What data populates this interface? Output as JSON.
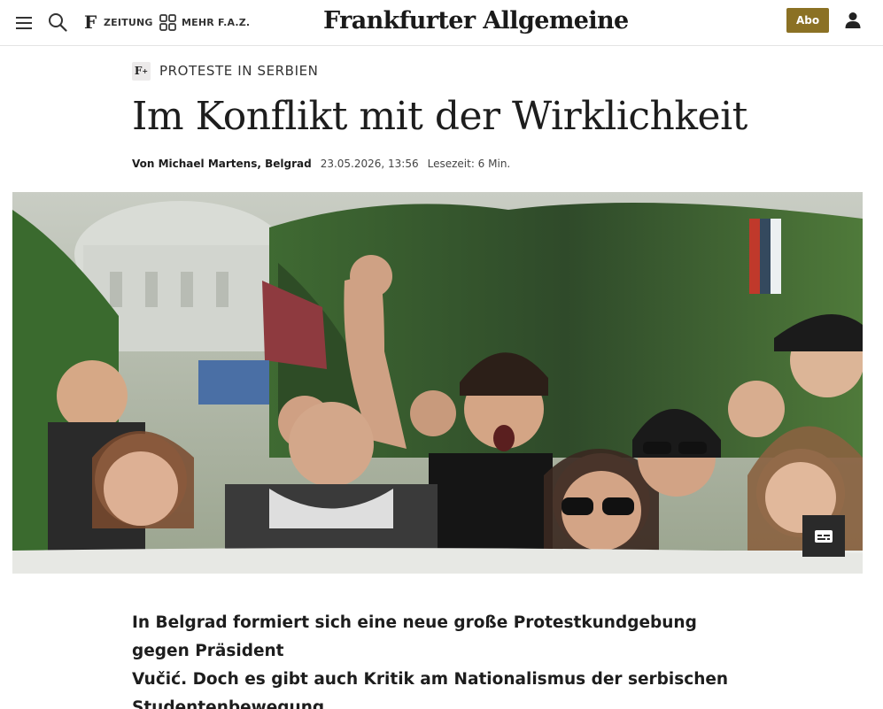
{
  "header": {
    "nav_zeitung": "ZEITUNG",
    "nav_mehr": "MEHR F.A.Z.",
    "logo_text": "Frankfurter Allgemeine",
    "abo_label": "Abo",
    "icons": [
      "menu-icon",
      "search-icon",
      "f-logo-icon",
      "grid-icon",
      "user-icon"
    ]
  },
  "article": {
    "kicker_badge": "F",
    "kicker_badge_plus": "+",
    "kicker": "PROTESTE IN SERBIEN",
    "headline": "Im Konflikt mit der Wirklichkeit",
    "author": "Von Michael Martens, Belgrad",
    "date": "23.05.2026, 13:56",
    "reading_time": "Lesezeit: 6 Min.",
    "teaser_line1": "In Belgrad formiert sich eine neue große Protestkundgebung gegen Präsident",
    "teaser_line2": "Vučić. Doch es gibt auch Kritik am Nationalismus der serbischen",
    "teaser_line3": "Studentenbewegung.",
    "image_alt": "Protesters marching with raised fist behind a banner in Belgrade",
    "caption_button": "captions-icon"
  },
  "colors": {
    "abo_gold": "#8b7124",
    "text": "#1d1d1d",
    "divider": "#e3e3e3"
  }
}
